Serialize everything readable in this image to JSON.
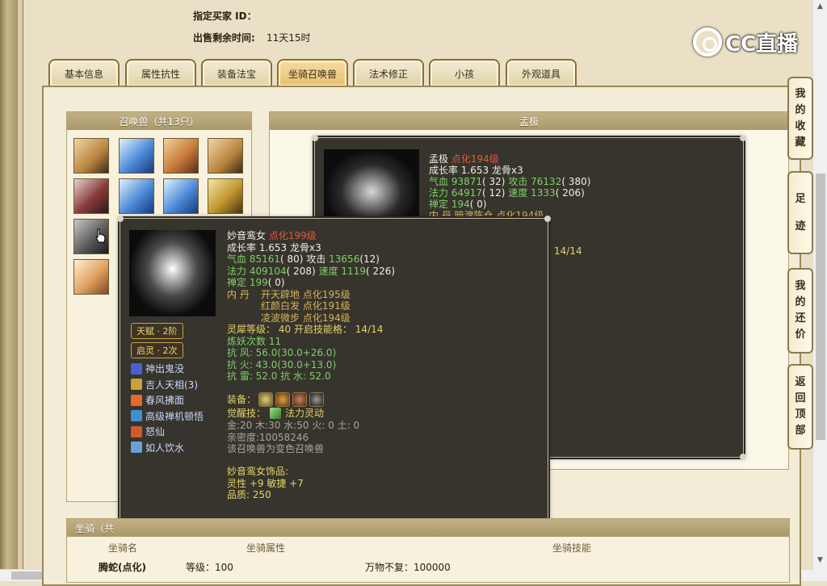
{
  "header": {
    "buyer_label": "指定买家 ID：",
    "buyer_value": "",
    "time_label": "出售剩余时间:",
    "time_value": "11天15时"
  },
  "logo": {
    "text": "CC直播",
    "icon": "cc-logo-icon"
  },
  "tabs": [
    {
      "label": "基本信息"
    },
    {
      "label": "属性抗性"
    },
    {
      "label": "装备法宝"
    },
    {
      "label": "坐骑召唤兽",
      "active": true
    },
    {
      "label": "法术修正"
    },
    {
      "label": "小孩"
    },
    {
      "label": "外观道具"
    }
  ],
  "summons_panel": {
    "title": "召唤兽（共13只）"
  },
  "detail_panel": {
    "title": "孟极"
  },
  "side_buttons": [
    {
      "label": "我的收藏"
    },
    {
      "label": "足迹"
    },
    {
      "label": "我的还价"
    },
    {
      "label": "返回顶部"
    }
  ],
  "mount_panel": {
    "title": "坐骑（共",
    "columns": [
      "坐骑名",
      "坐骑属性",
      "坐骑技能"
    ],
    "row": {
      "name": "腾蛇(点化)",
      "attr": "等级：100",
      "skill": "万物不复：100000"
    }
  },
  "card_back": {
    "name": "孟极",
    "rank": "点化194级",
    "growth": "成长率 1.653 龙骨x3",
    "hp_label": "气血",
    "hp": "93871",
    "hp_extra": "( 32)",
    "atk_label": "攻击",
    "atk": "76132",
    "atk_extra": "( 380)",
    "mp_label": "法力",
    "mp": "64917",
    "mp_extra": "( 12)",
    "spd_label": "速度",
    "spd": "1333",
    "spd_extra": "( 206)",
    "focus_label": "禅定",
    "focus": "194",
    "focus_extra": "( 0)",
    "inner": "内    丹 暗渡陈仓 点化194级",
    "partial_value": "14/14"
  },
  "card_front": {
    "name": "妙音鸾女",
    "rank": "点化199级",
    "growth": "成长率 1.653 龙骨x3",
    "hp_label": "气血",
    "hp": "85161",
    "hp_extra": "( 80)",
    "atk_label": "攻击",
    "atk": "13656",
    "atk_extra": "(12)",
    "mp_label": "法力",
    "mp": "409104",
    "mp_extra": "( 208)",
    "spd_label": "速度",
    "spd": "1119",
    "spd_extra": "( 226)",
    "focus_label": "禅定",
    "focus": "199",
    "focus_extra": "( 0)",
    "inner_label": "内    丹",
    "inner1": "开天辟地 点化195级",
    "inner2": "红颜白发 点化191级",
    "inner3": "凌波微步 点化194级",
    "spirit_label": "灵犀等级：",
    "spirit_value": "40",
    "spirit_skill_label": "开启技能格：",
    "spirit_skill_value": "14/14",
    "refine": "炼妖次数 11",
    "res1": "抗    风: 56.0(30.0+26.0)",
    "res2": "抗    火: 43.0(30.0+13.0)",
    "res3": "抗    雷: 52.0 抗    水: 52.0",
    "equip_label": "装备：",
    "awaken_label": "觉醒技：",
    "awaken_value": "法力灵动",
    "elements": "金:20 木:30 水:50 火: 0 土: 0",
    "intimacy": "亲密度:10058246",
    "variant": "该召唤兽为变色召唤兽",
    "ornament_title": "妙音鸾女饰品:",
    "ornament_stats": "灵性 +9 敏捷 +7",
    "ornament_quality": "品质:   250",
    "talent": "天赋 · 2阶",
    "spirit_pill": "启灵 · 2次",
    "skills": [
      {
        "name": "神出鬼没",
        "color": "#4a5fd0"
      },
      {
        "name": "吉人天相(3)",
        "color": "#c9a13b"
      },
      {
        "name": "春风拂面",
        "color": "#e06b2b"
      },
      {
        "name": "高级禅机顿悟",
        "color": "#3f8fd0"
      },
      {
        "name": "怒仙",
        "color": "#d05a2a"
      },
      {
        "name": "如人饮水",
        "color": "#6aa0d8"
      }
    ]
  },
  "colors": {
    "accent_red": "#e05a3a",
    "stat_green": "#7fd06a",
    "highlight_yellow": "#e7d268"
  }
}
